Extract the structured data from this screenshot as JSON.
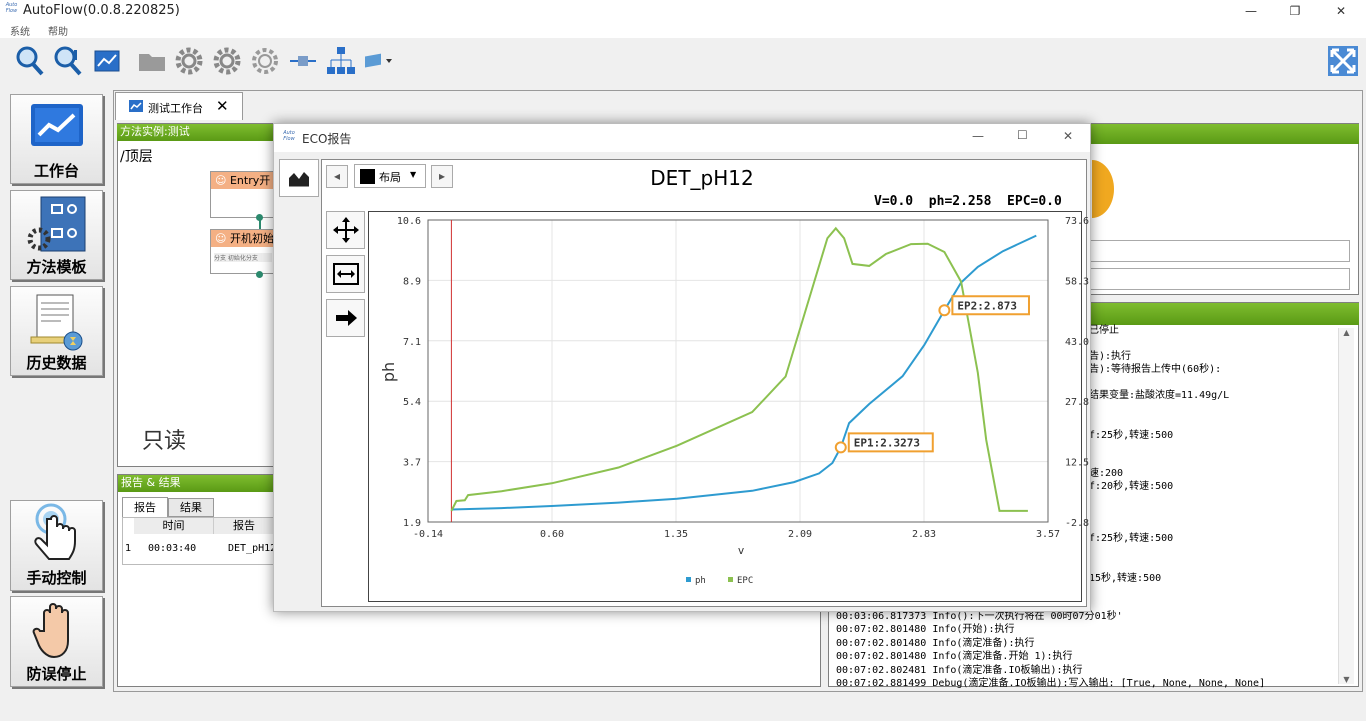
{
  "app": {
    "title": "AutoFlow(0.0.8.220825)",
    "icon_text": "Auto Flow",
    "min": "—",
    "max": "❐",
    "close": "✕"
  },
  "menu": [
    "系统",
    "帮助"
  ],
  "sidebar": {
    "workbench": "工作台",
    "method_template": "方法模板",
    "history": "历史数据",
    "manual_control": "手动控制",
    "stop": "防误停止"
  },
  "workspace": {
    "tab_label": "测试工作台",
    "tab_close": "✕"
  },
  "method_panel": {
    "header": "方法实例:测试",
    "breadcrumb": "/顶层",
    "node1": "Entry开",
    "node2": "开机初始",
    "node2_sub": "分支 初始化分支",
    "readonly": "只读"
  },
  "report_panel": {
    "header": "报告 & 结果",
    "tab_report": "报告",
    "tab_result": "结果",
    "col_time": "时间",
    "col_report": "报告",
    "row_index": "1",
    "row_time": "00:03:40",
    "row_report": "DET_pH12"
  },
  "log_fragments": [
    "已停止",
    "告):执行",
    "告):等待报告上传中(60秒):",
    "结果变量:盐酸浓度=11.49g/L",
    "f:25秒,转速:500",
    "速:200",
    "f:20秒,转速:500",
    "f:25秒,转速:500",
    "15秒,转速:500"
  ],
  "log_lines": [
    "00:03:06.817373 Info():下一次执行将在 00时07分01秒'",
    "00:07:02.801480 Info(开始):执行",
    "00:07:02.801480 Info(滴定准备):执行",
    "00:07:02.801480 Info(滴定准备.开始 1):执行",
    "00:07:02.802481 Info(滴定准备.IO板输出):执行",
    "00:07:02.881499 Debug(滴定准备.IO板输出):写入输出: [True, None, None, None]"
  ],
  "dialog": {
    "title": "ECO报告",
    "icon_text": "Auto Flow",
    "min": "—",
    "max": "☐",
    "close": "✕",
    "layout_label": "布局",
    "nav_prev": "◂",
    "nav_next": "▸",
    "dropdown_arrow": "▼"
  },
  "colors": {
    "ph": "#2e9bd0",
    "epc": "#8cc150",
    "marker": "#f0a030",
    "cursor": "#d03030",
    "green_header": "#6aad22"
  },
  "chart_data": {
    "type": "line",
    "title": "DET_pH12",
    "readout": "V=0.0  ph=2.258  EPC=0.0",
    "xlabel": "v",
    "ylabel": "ph",
    "xlim": [
      -0.14,
      3.57
    ],
    "ylim": [
      1.9,
      10.6
    ],
    "y2lim": [
      -2.8,
      73.6
    ],
    "x_ticks": [
      "-0.14",
      "0.60",
      "1.35",
      "2.09",
      "2.83",
      "3.57"
    ],
    "y_ticks": [
      "10.6",
      "8.9",
      "7.1",
      "5.4",
      "3.7",
      "1.9"
    ],
    "y2_ticks": [
      "73.6",
      "58.3",
      "43.0",
      "27.8",
      "12.5",
      "-2.8"
    ],
    "cursor_x": 0.0,
    "series": [
      {
        "name": "ph",
        "axis": "left",
        "color": "#2e9bd0",
        "points": [
          [
            0.0,
            2.26
          ],
          [
            0.3,
            2.3
          ],
          [
            0.6,
            2.36
          ],
          [
            1.0,
            2.46
          ],
          [
            1.35,
            2.57
          ],
          [
            1.8,
            2.8
          ],
          [
            2.05,
            3.05
          ],
          [
            2.2,
            3.3
          ],
          [
            2.28,
            3.6
          ],
          [
            2.33,
            4.05
          ],
          [
            2.38,
            4.75
          ],
          [
            2.5,
            5.3
          ],
          [
            2.7,
            6.1
          ],
          [
            2.83,
            7.0
          ],
          [
            2.95,
            8.0
          ],
          [
            3.05,
            8.8
          ],
          [
            3.15,
            9.25
          ],
          [
            3.3,
            9.7
          ],
          [
            3.5,
            10.15
          ]
        ]
      },
      {
        "name": "EPC",
        "axis": "right",
        "color": "#8cc150",
        "points": [
          [
            0.0,
            0.0
          ],
          [
            0.03,
            2.5
          ],
          [
            0.08,
            2.7
          ],
          [
            0.1,
            4.0
          ],
          [
            0.3,
            5.0
          ],
          [
            0.6,
            7.0
          ],
          [
            1.0,
            11.0
          ],
          [
            1.35,
            16.5
          ],
          [
            1.8,
            25.0
          ],
          [
            2.0,
            34.0
          ],
          [
            2.15,
            55.0
          ],
          [
            2.25,
            69.0
          ],
          [
            2.3,
            71.5
          ],
          [
            2.35,
            69.0
          ],
          [
            2.4,
            62.5
          ],
          [
            2.5,
            62.0
          ],
          [
            2.6,
            65.0
          ],
          [
            2.75,
            67.5
          ],
          [
            2.85,
            67.6
          ],
          [
            2.95,
            65.5
          ],
          [
            3.05,
            58.0
          ],
          [
            3.15,
            35.0
          ],
          [
            3.2,
            18.0
          ],
          [
            3.28,
            0.0
          ],
          [
            3.45,
            0.0
          ]
        ]
      }
    ],
    "markers": [
      {
        "label": "EP1:2.3273",
        "x": 2.33,
        "y": 4.05
      },
      {
        "label": "EP2:2.873",
        "x": 2.95,
        "y": 8.0
      }
    ],
    "legend": {
      "placement": "bottom-center",
      "items": [
        "ph",
        "EPC"
      ]
    }
  }
}
